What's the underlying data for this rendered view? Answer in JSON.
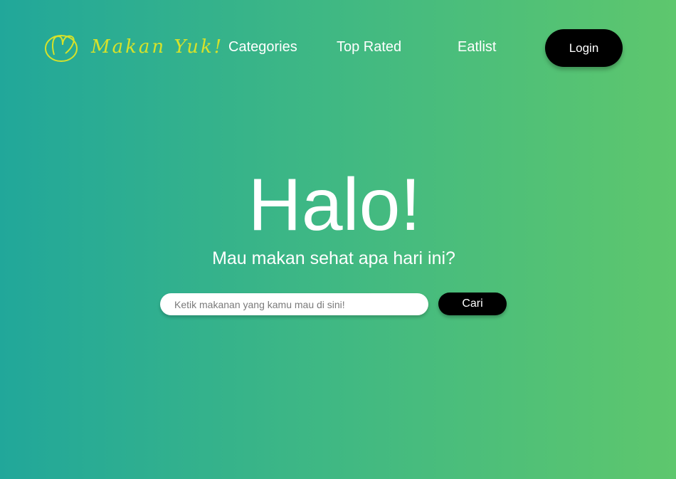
{
  "navbar": {
    "logo": {
      "icon": "heart-bowl-logo-icon",
      "text": "Makan Yuk!",
      "color": "#d6e22a"
    },
    "links": [
      {
        "label": "Categories"
      },
      {
        "label": "Top Rated"
      },
      {
        "label": "Eatlist"
      }
    ],
    "login_label": "Login"
  },
  "hero": {
    "title": "Halo!",
    "subtitle": "Mau makan sehat apa hari ini?"
  },
  "search": {
    "placeholder": "Ketik makanan yang kamu mau di sini!",
    "value": "",
    "button_label": "Cari"
  },
  "colors": {
    "gradient_start": "#21a79a",
    "gradient_end": "#5ec76d",
    "button_bg": "#000000",
    "text": "#ffffff"
  }
}
